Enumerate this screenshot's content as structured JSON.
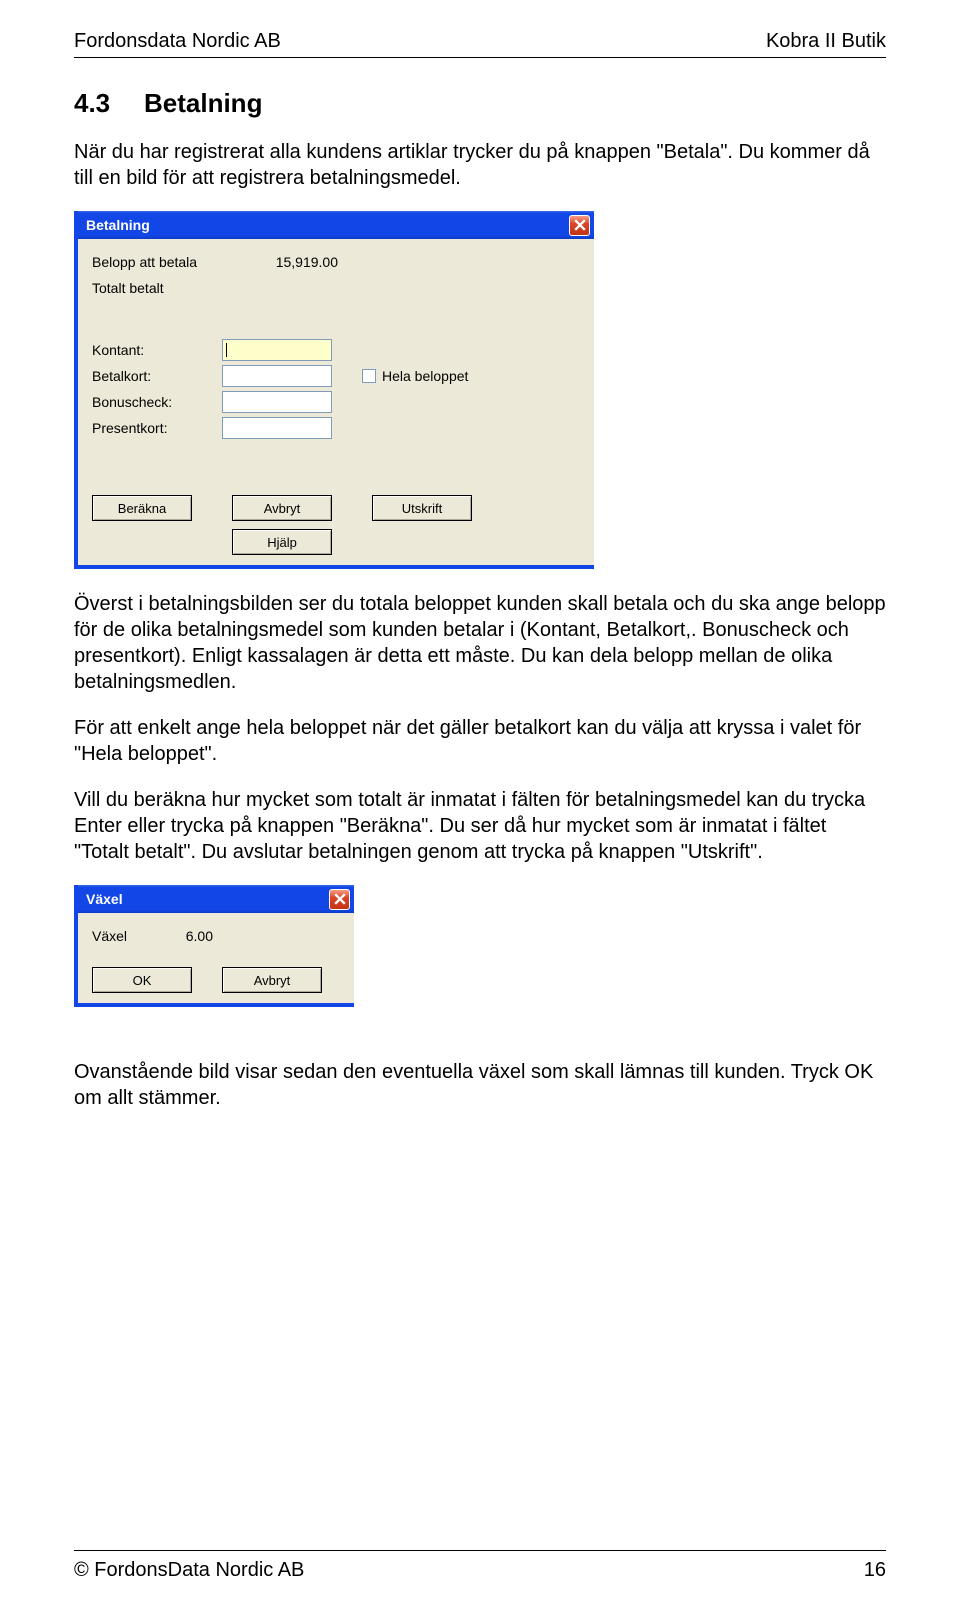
{
  "header": {
    "left": "Fordonsdata Nordic AB",
    "right": "Kobra II Butik"
  },
  "section": {
    "number": "4.3",
    "title": "Betalning"
  },
  "para1": "När du har registrerat alla kundens artiklar trycker du på knappen \"Betala\". Du kommer då till en bild för att registrera betalningsmedel.",
  "dialog1": {
    "title": "Betalning",
    "amount_to_pay_label": "Belopp att betala",
    "amount_to_pay_value": "15,919.00",
    "total_paid_label": "Totalt betalt",
    "total_paid_value": "",
    "kontant_label": "Kontant:",
    "betalkort_label": "Betalkort:",
    "bonuscheck_label": "Bonuscheck:",
    "presentkort_label": "Presentkort:",
    "whole_amount_label": "Hela beloppet",
    "btn_calc": "Beräkna",
    "btn_cancel": "Avbryt",
    "btn_print": "Utskrift",
    "btn_help": "Hjälp"
  },
  "para2": "Överst i betalningsbilden ser du totala beloppet kunden skall betala och du ska ange belopp för de olika betalningsmedel som kunden betalar i (Kontant, Betalkort,. Bonuscheck och presentkort). Enligt kassalagen är detta ett måste. Du kan dela belopp mellan de olika betalningsmedlen.",
  "para3": "För att enkelt ange hela beloppet när det gäller betalkort kan du välja att kryssa i valet för \"Hela beloppet\".",
  "para4": "Vill du beräkna hur mycket som totalt är inmatat i fälten för betalningsmedel kan du trycka Enter eller trycka på knappen \"Beräkna\". Du ser då hur mycket som är inmatat i fältet \"Totalt betalt\". Du avslutar betalningen genom att trycka på knappen \"Utskrift\".",
  "dialog2": {
    "title": "Växel",
    "vaxel_label": "Växel",
    "vaxel_value": "6.00",
    "btn_ok": "OK",
    "btn_cancel": "Avbryt"
  },
  "para5": "Ovanstående bild visar sedan den eventuella växel som skall lämnas till kunden. Tryck OK om allt stämmer.",
  "footer": {
    "left": "© FordonsData Nordic AB",
    "right": "16"
  }
}
